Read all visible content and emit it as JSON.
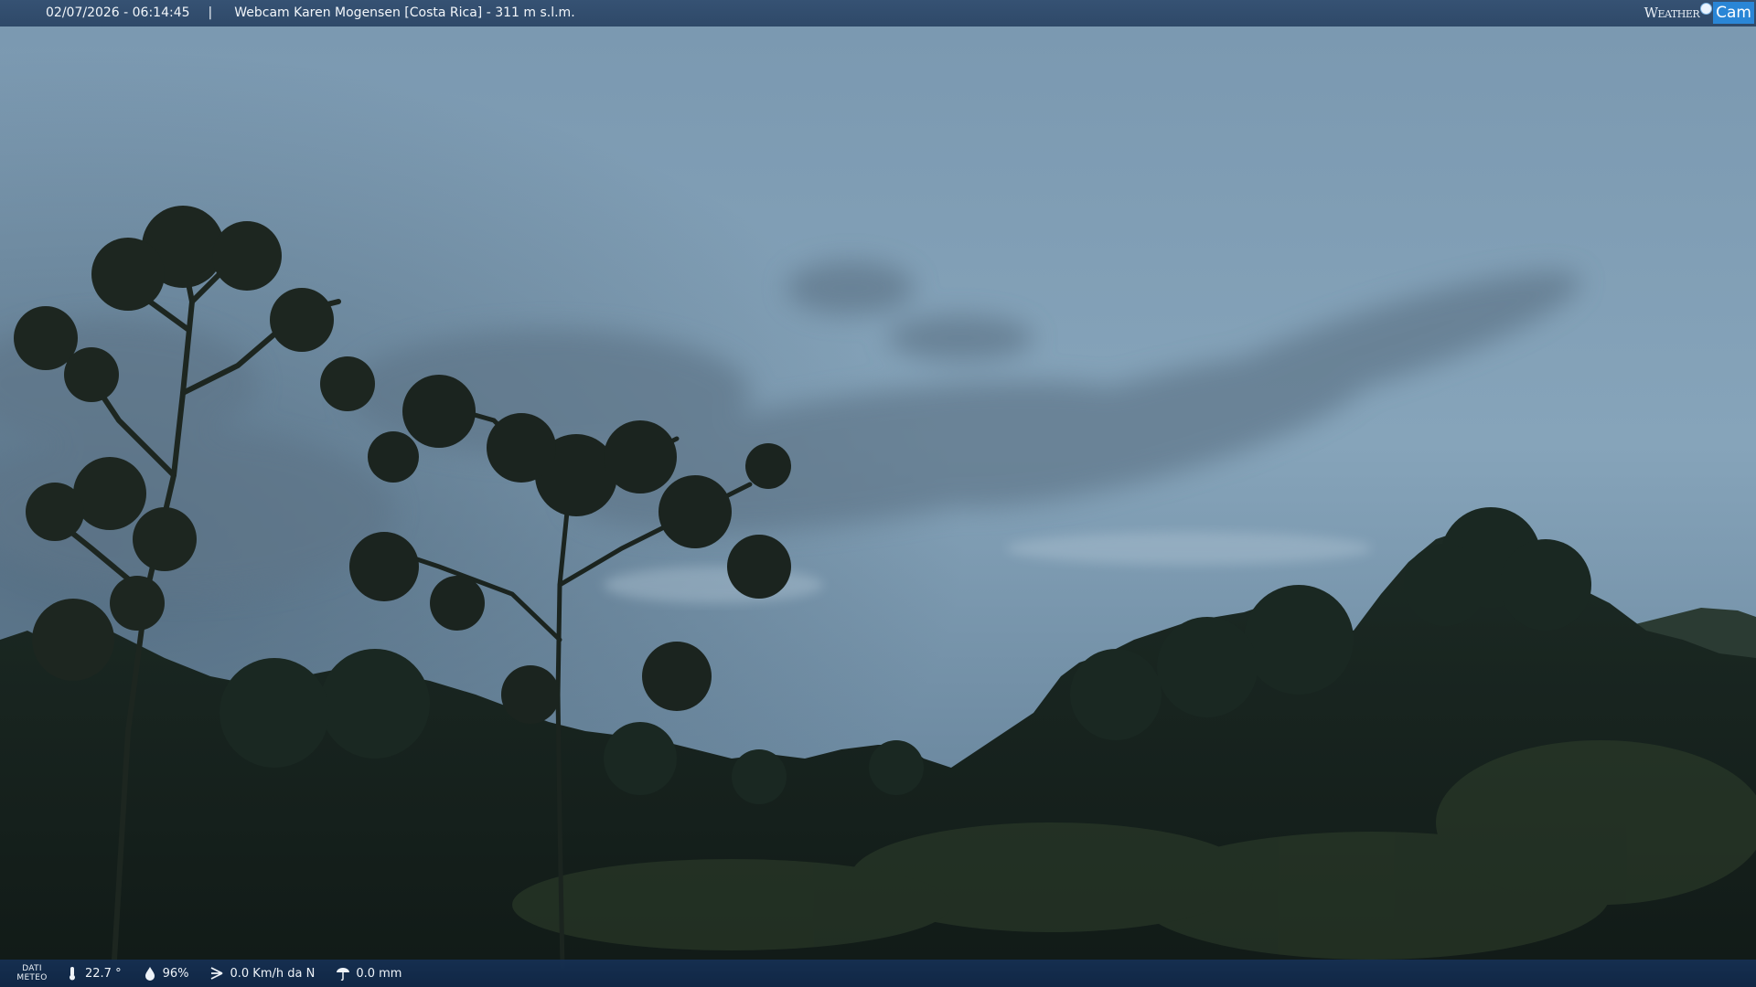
{
  "header": {
    "timestamp": "02/07/2026 - 06:14:45",
    "separator": "|",
    "title": "Webcam Karen Mogensen [Costa Rica]  - 311 m s.l.m."
  },
  "logo": {
    "word": "Weather",
    "cam": "Cam"
  },
  "meteo": {
    "section_label_1": "DATI",
    "section_label_2": "METEO",
    "temperature": "22.7 °",
    "humidity": "96%",
    "wind": "0.0 Km/h da N",
    "rain": "0.0 mm"
  },
  "icons": [
    "thermometer-icon",
    "humidity-icon",
    "wind-icon",
    "rain-icon"
  ],
  "colors": {
    "sky": "#7e9cb3",
    "bar": "#2b4a70",
    "logo_accent": "#2a86d6"
  }
}
